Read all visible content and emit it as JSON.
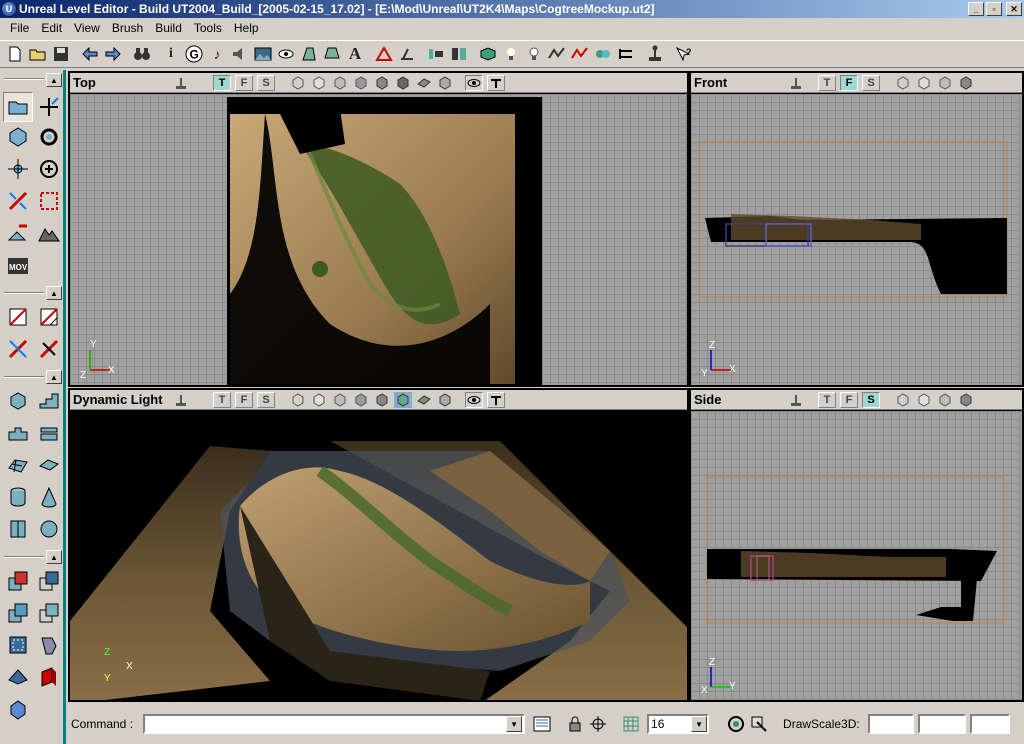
{
  "window": {
    "title": "Unreal Level Editor - Build UT2004_Build_[2005-02-15_17.02] - [E:\\Mod\\Unreal\\UT2K4\\Maps\\CogtreeMockup.ut2]",
    "app_icon_letter": "U",
    "minimize": "_",
    "maximize": "▫",
    "close": "✕"
  },
  "menu": [
    {
      "label": "File"
    },
    {
      "label": "Edit"
    },
    {
      "label": "View"
    },
    {
      "label": "Brush"
    },
    {
      "label": "Build"
    },
    {
      "label": "Tools"
    },
    {
      "label": "Help"
    }
  ],
  "toolbar": {
    "icons": [
      "new-icon",
      "open-icon",
      "save-icon",
      "undo-icon",
      "redo-icon",
      "binoculars-icon",
      "info-icon",
      "g-icon",
      "music-icon",
      "sound-icon",
      "texture-icon",
      "mesh-icon",
      "animation-icon",
      "static-mesh-icon",
      "text-icon",
      "terrain-icon",
      "matinee-icon",
      "build-geometry-icon",
      "build-lighting-icon",
      "build-paths-icon",
      "build-options-icon",
      "build-all-icon",
      "play-level-icon",
      "help-icon"
    ]
  },
  "viewports": {
    "top": {
      "title": "Top",
      "mode_letters": [
        "T",
        "F",
        "S"
      ],
      "active": "T",
      "axes": {
        "v": "Y",
        "h": "X",
        "z": "Z"
      }
    },
    "front": {
      "title": "Front",
      "mode_letters": [
        "T",
        "F",
        "S"
      ],
      "active": "F",
      "axes": {
        "v": "Z",
        "h": "X",
        "z": "Y"
      }
    },
    "perspective": {
      "title": "Dynamic Light",
      "mode_letters": [
        "T",
        "F",
        "S"
      ],
      "active": "",
      "axes": {
        "v": "Z",
        "h": "X",
        "z": "Y"
      }
    },
    "side": {
      "title": "Side",
      "mode_letters": [
        "T",
        "F",
        "S"
      ],
      "active": "S",
      "axes": {
        "v": "Z",
        "h": "Y",
        "z": "X"
      }
    }
  },
  "statusbar": {
    "command_label": "Command :",
    "command_value": "",
    "grid_value": "16",
    "drawscale_label": "DrawScale3D:",
    "drawscale_x": "",
    "drawscale_y": "",
    "drawscale_z": ""
  },
  "colors": {
    "titlebar_start": "#0a246a",
    "titlebar_end": "#a6caf0",
    "accent_teal": "#008080",
    "active_mode": "#9fd8d0",
    "terrain": "#8a7350"
  }
}
